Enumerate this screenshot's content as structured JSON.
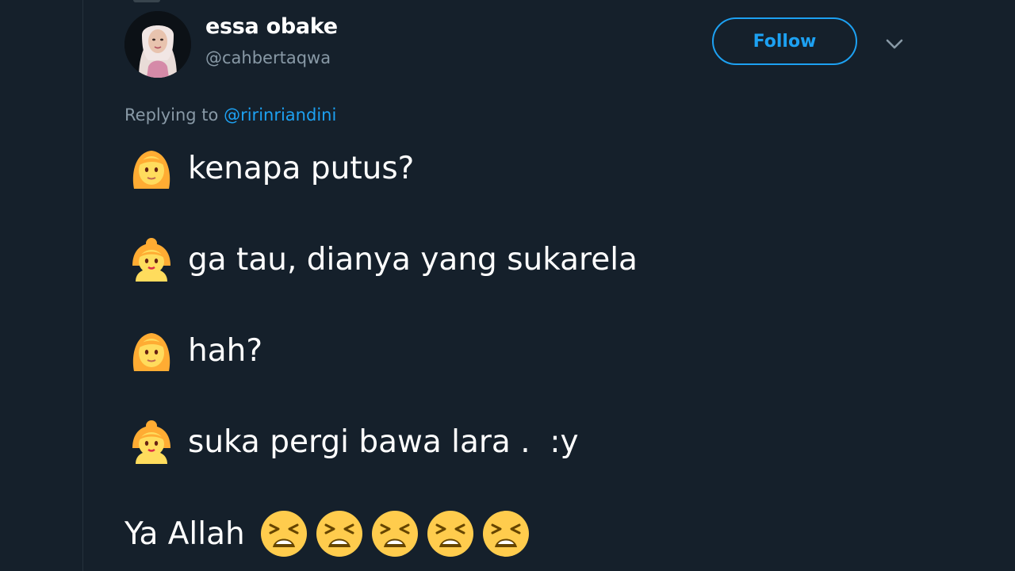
{
  "tweet": {
    "display_name": "essa obake",
    "handle": "@cahbertaqwa",
    "follow_label": "Follow",
    "replying_prefix": "Replying to",
    "replying_mention": "@ririnriandini",
    "lines": [
      {
        "icon": "woman-emoji-icon",
        "text": "kenapa putus?"
      },
      {
        "icon": "child-emoji-icon",
        "text": "ga tau, dianya yang sukarela"
      },
      {
        "icon": "woman-emoji-icon",
        "text": "hah?"
      },
      {
        "icon": "child-emoji-icon",
        "text": "suka pergi bawa lara .  :y"
      }
    ],
    "final_text": "Ya Allah",
    "final_icon": "tired-face-emoji-icon",
    "final_icon_count": 5
  },
  "colors": {
    "background": "#15202b",
    "accent": "#1da1f2",
    "muted": "#8899a6",
    "text": "#ffffff",
    "emoji_yellow": "#ffcc4d"
  }
}
